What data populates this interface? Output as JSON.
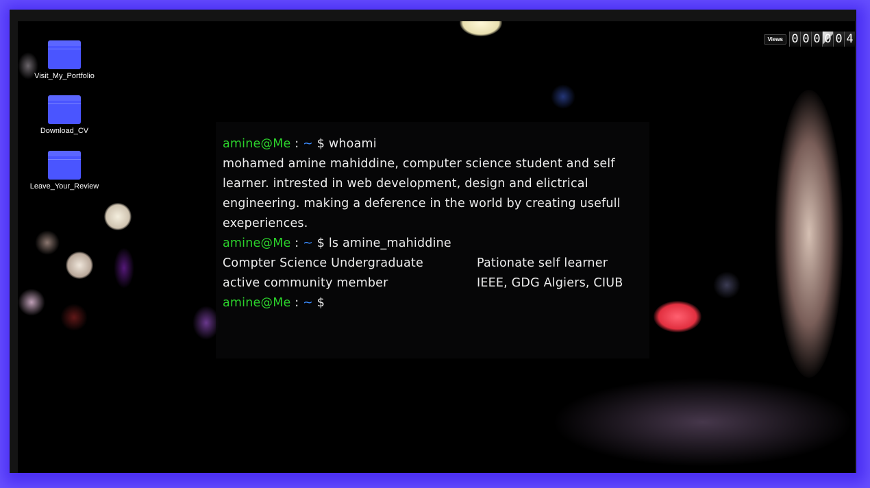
{
  "desktop": {
    "icons": [
      {
        "label": "Visit_My_Portfolio",
        "icon": "folder-icon"
      },
      {
        "label": "Download_CV",
        "icon": "folder-icon"
      },
      {
        "label": "Leave_Your_Review",
        "icon": "folder-icon"
      }
    ]
  },
  "views_counter": {
    "label": "Views",
    "digits": [
      "0",
      "0",
      "0",
      "0",
      "0",
      "4"
    ]
  },
  "terminal": {
    "prompt_user": "amine@Me",
    "prompt_sep": ":",
    "prompt_path": "~",
    "prompt_symbol": "$",
    "cmd1": "whoami",
    "output1": "mohamed amine mahiddine, computer science student and self learner. intrested in web development, design and elictrical engineering. making a deference in the world by creating usefull exeperiences.",
    "cmd2": "ls amine_mahiddine",
    "ls_rows": [
      [
        "Compter Science Undergraduate",
        "Pationate self learner"
      ],
      [
        "active community member",
        "IEEE, GDG Algiers, CIUB"
      ]
    ]
  },
  "colors": {
    "frame": "#4a2ff3",
    "prompt_user": "#2cd22c",
    "prompt_path": "#3b8cff",
    "folder": "#4a55ff"
  }
}
